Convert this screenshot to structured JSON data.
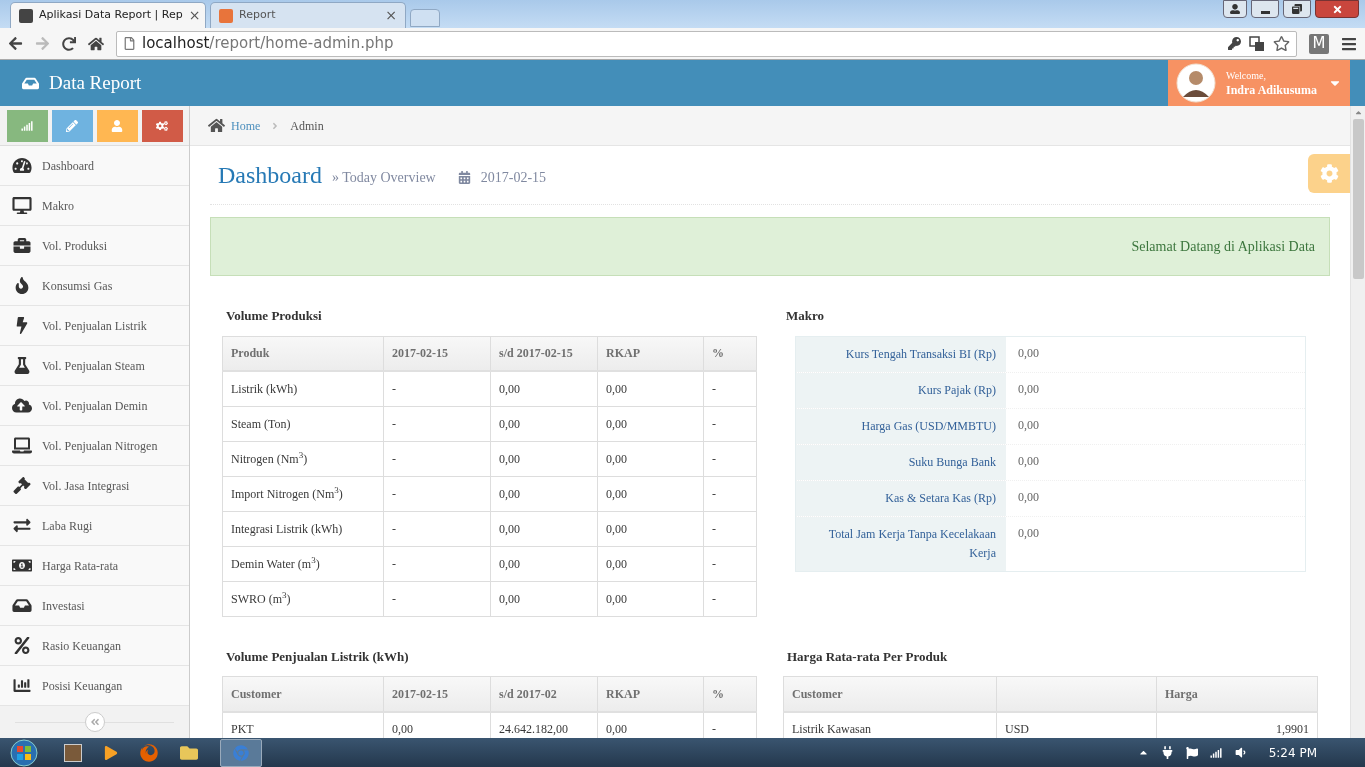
{
  "browser": {
    "tabs": [
      {
        "title": "Aplikasi Data Report | Rep",
        "selected": true
      },
      {
        "title": "Report",
        "selected": false
      }
    ],
    "close_glyph": "×",
    "address": {
      "host": "localhost",
      "path": "/report/home-admin.php"
    },
    "extension": "M"
  },
  "header": {
    "title": "Data Report",
    "user": {
      "greeting": "Welcome,",
      "name": "Indra Adikusuma"
    }
  },
  "sidebar": {
    "shortcuts": [
      {
        "color": "#87b87f"
      },
      {
        "color": "#6fb3e0"
      },
      {
        "color": "#ffb752"
      },
      {
        "color": "#d15b47"
      }
    ],
    "items": [
      "Dashboard",
      "Makro",
      "Vol. Produksi",
      "Konsumsi Gas",
      "Vol. Penjualan Listrik",
      "Vol. Penjualan Steam",
      "Vol. Penjualan Demin",
      "Vol. Penjualan Nitrogen",
      "Vol. Jasa Integrasi",
      "Laba Rugi",
      "Harga Rata-rata",
      "Investasi",
      "Rasio Keuangan",
      "Posisi Keuangan"
    ]
  },
  "breadcrumb": [
    "Home",
    "Admin"
  ],
  "page_header": {
    "title": "Dashboard",
    "subtitle": "» Today Overview",
    "date": "2017-02-15"
  },
  "alert": "Selamat Datang di Aplikasi Data",
  "volume_produksi": {
    "title": "Volume Produksi",
    "columns": [
      "Produk",
      "2017-02-15",
      "s/d 2017-02-15",
      "RKAP",
      "%"
    ],
    "rows": [
      [
        "Listrik (kWh)",
        "-",
        "0,00",
        "0,00",
        "-"
      ],
      [
        "Steam (Ton)",
        "-",
        "0,00",
        "0,00",
        "-"
      ],
      [
        "Nitrogen (Nm$^{3}$)",
        "-",
        "0,00",
        "0,00",
        "-"
      ],
      [
        "Import Nitrogen (Nm$^{3}$)",
        "-",
        "0,00",
        "0,00",
        "-"
      ],
      [
        "Integrasi Listrik (kWh)",
        "-",
        "0,00",
        "0,00",
        "-"
      ],
      [
        "Demin Water (m$^{3}$)",
        "-",
        "0,00",
        "0,00",
        "-"
      ],
      [
        "SWRO (m$^{3}$)",
        "-",
        "0,00",
        "0,00",
        "-"
      ]
    ]
  },
  "makro": {
    "title": "Makro",
    "rows": [
      {
        "label": "Kurs Tengah Transaksi BI (Rp)",
        "value": "0,00"
      },
      {
        "label": "Kurs Pajak (Rp)",
        "value": "0,00"
      },
      {
        "label": "Harga Gas (USD/MMBTU)",
        "value": "0,00"
      },
      {
        "label": "Suku Bunga Bank",
        "value": "0,00"
      },
      {
        "label": "Kas & Setara Kas (Rp)",
        "value": "0,00"
      },
      {
        "label": "Total Jam Kerja Tanpa Kecelakaan Kerja",
        "value": "0,00"
      }
    ]
  },
  "penjualan_listrik": {
    "title": "Volume Penjualan Listrik (kWh)",
    "columns": [
      "Customer",
      "2017-02-15",
      "s/d 2017-02",
      "RKAP",
      "%"
    ],
    "rows": [
      [
        "PKT",
        "0,00",
        "24.642.182,00",
        "0,00",
        "-"
      ]
    ]
  },
  "harga": {
    "title": "Harga Rata-rata Per Produk",
    "columns": [
      "Customer",
      "",
      "Harga"
    ],
    "rows": [
      [
        "Listrik Kawasan",
        "USD",
        "1,9901"
      ]
    ]
  },
  "taskbar": {
    "time": "5:24 PM"
  }
}
